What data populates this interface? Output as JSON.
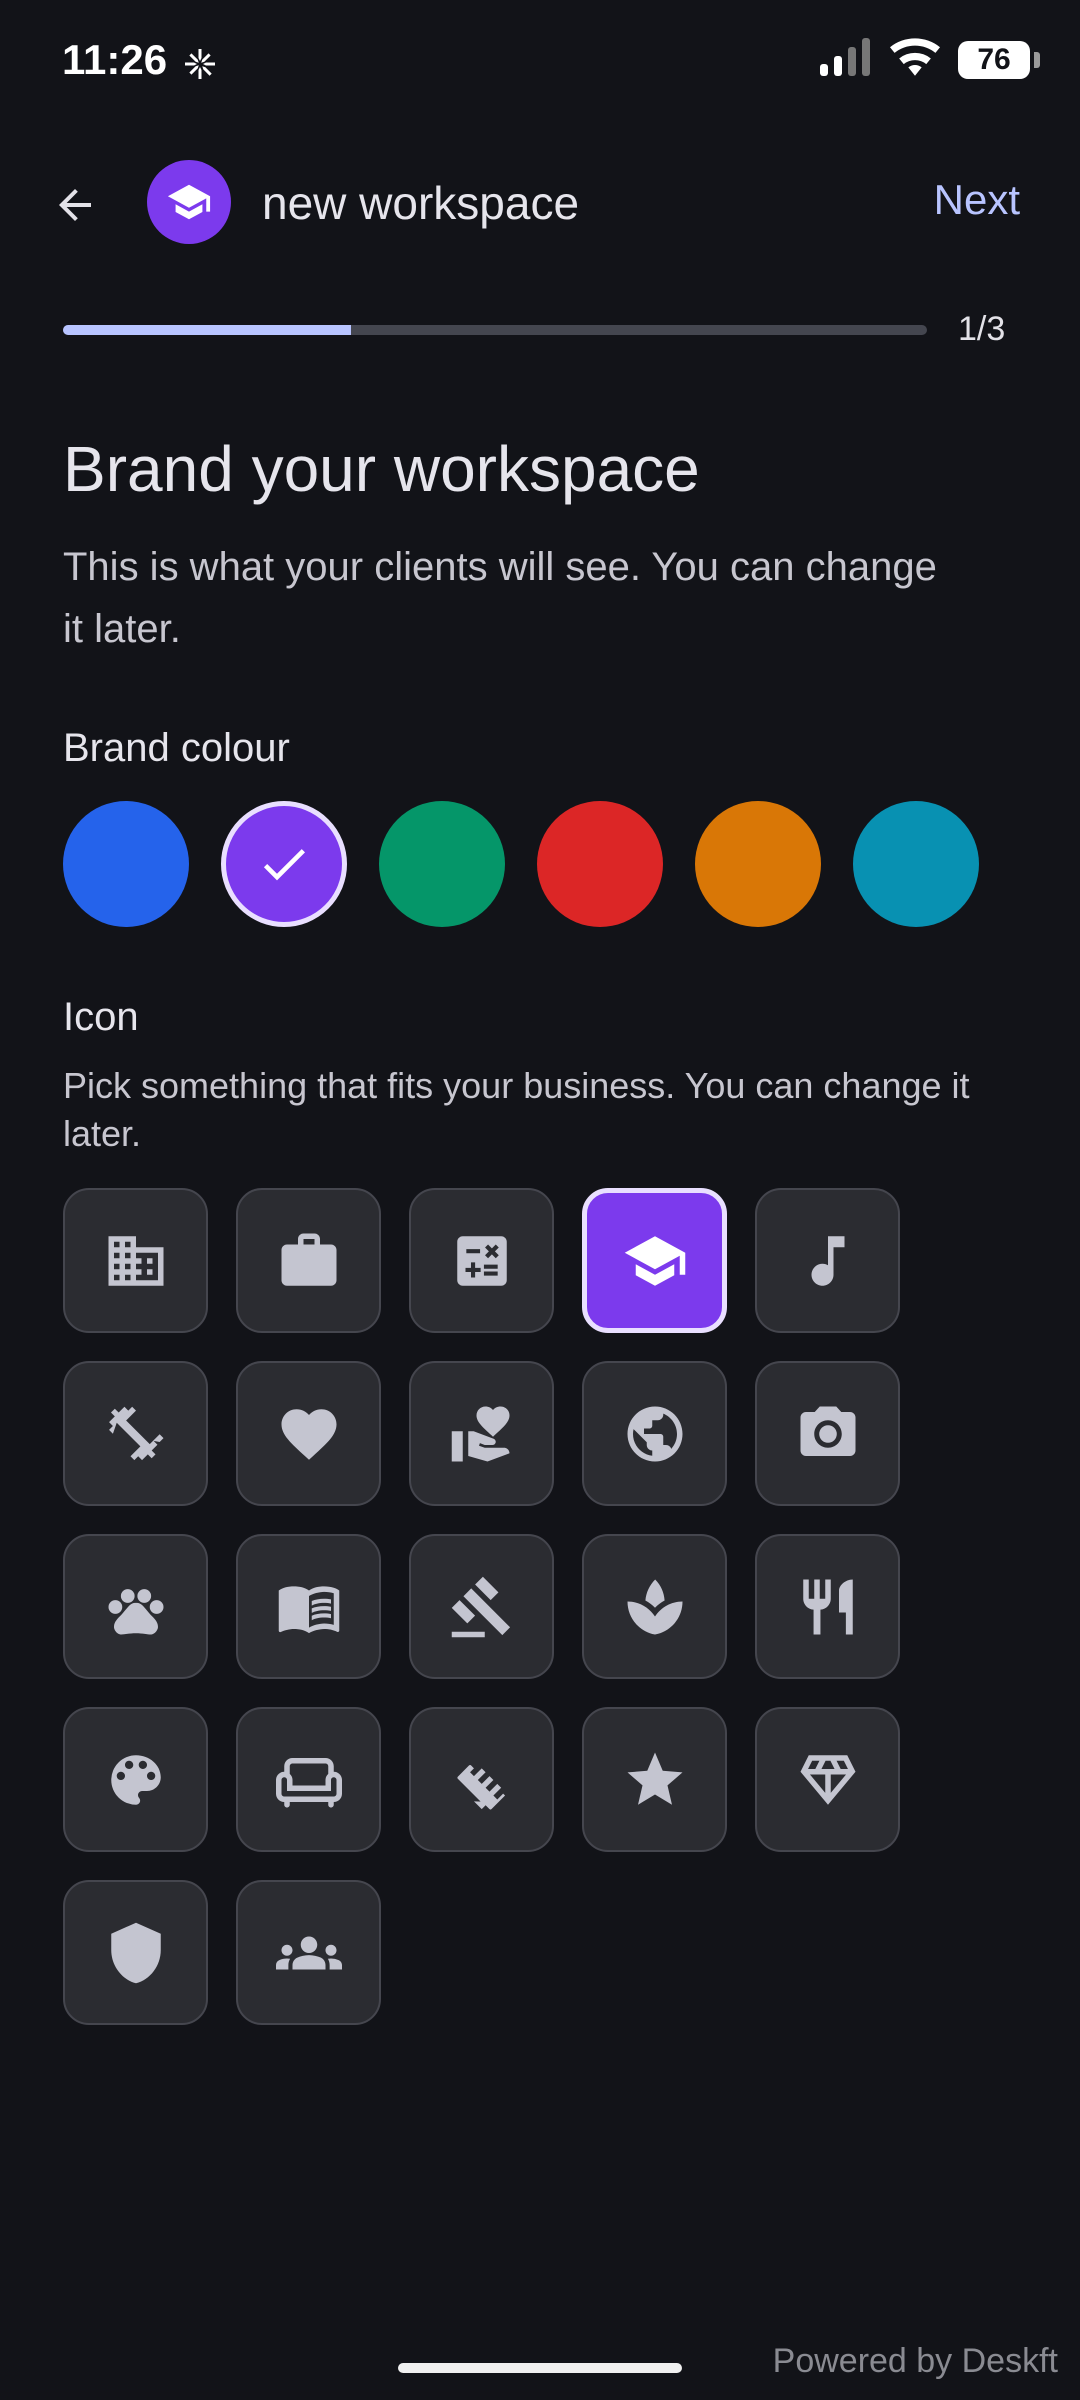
{
  "status_bar": {
    "time": "11:26",
    "battery": "76"
  },
  "header": {
    "title": "new workspace",
    "next_label": "Next"
  },
  "progress": {
    "label": "1/3",
    "fraction": 0.333
  },
  "main": {
    "heading": "Brand your workspace",
    "subtext": "This is what your clients will see. You can change it later.",
    "brand_colour_label": "Brand colour",
    "icon_label": "Icon",
    "icon_subtext": "Pick something that fits your business. You can change it later."
  },
  "colours": [
    {
      "name": "blue",
      "hex": "#2563eb",
      "selected": false
    },
    {
      "name": "purple",
      "hex": "#7c3aed",
      "selected": true
    },
    {
      "name": "green",
      "hex": "#059669",
      "selected": false
    },
    {
      "name": "red",
      "hex": "#dc2626",
      "selected": false
    },
    {
      "name": "orange",
      "hex": "#d97706",
      "selected": false
    },
    {
      "name": "teal",
      "hex": "#0891b2",
      "selected": false
    }
  ],
  "icons": [
    {
      "name": "building-icon",
      "selected": false
    },
    {
      "name": "briefcase-icon",
      "selected": false
    },
    {
      "name": "calculator-icon",
      "selected": false
    },
    {
      "name": "graduation-cap-icon",
      "selected": true
    },
    {
      "name": "music-note-icon",
      "selected": false
    },
    {
      "name": "dumbbell-icon",
      "selected": false
    },
    {
      "name": "heart-icon",
      "selected": false
    },
    {
      "name": "real-estate-icon",
      "selected": false
    },
    {
      "name": "globe-icon",
      "selected": false
    },
    {
      "name": "camera-icon",
      "selected": false
    },
    {
      "name": "paw-icon",
      "selected": false
    },
    {
      "name": "book-icon",
      "selected": false
    },
    {
      "name": "gavel-icon",
      "selected": false
    },
    {
      "name": "spa-icon",
      "selected": false
    },
    {
      "name": "restaurant-icon",
      "selected": false
    },
    {
      "name": "palette-icon",
      "selected": false
    },
    {
      "name": "sofa-icon",
      "selected": false
    },
    {
      "name": "handshake-icon",
      "selected": false
    },
    {
      "name": "star-icon",
      "selected": false
    },
    {
      "name": "diamond-icon",
      "selected": false
    },
    {
      "name": "shield-icon",
      "selected": false
    },
    {
      "name": "group-icon",
      "selected": false
    }
  ],
  "footer": {
    "powered_by": "Powered by Deskft"
  },
  "theme": {
    "accent": "#b8c4ff",
    "selected_bg": "#7c3aed",
    "tile_bg": "#2b2c31",
    "icon_color": "#c4c5d0"
  }
}
